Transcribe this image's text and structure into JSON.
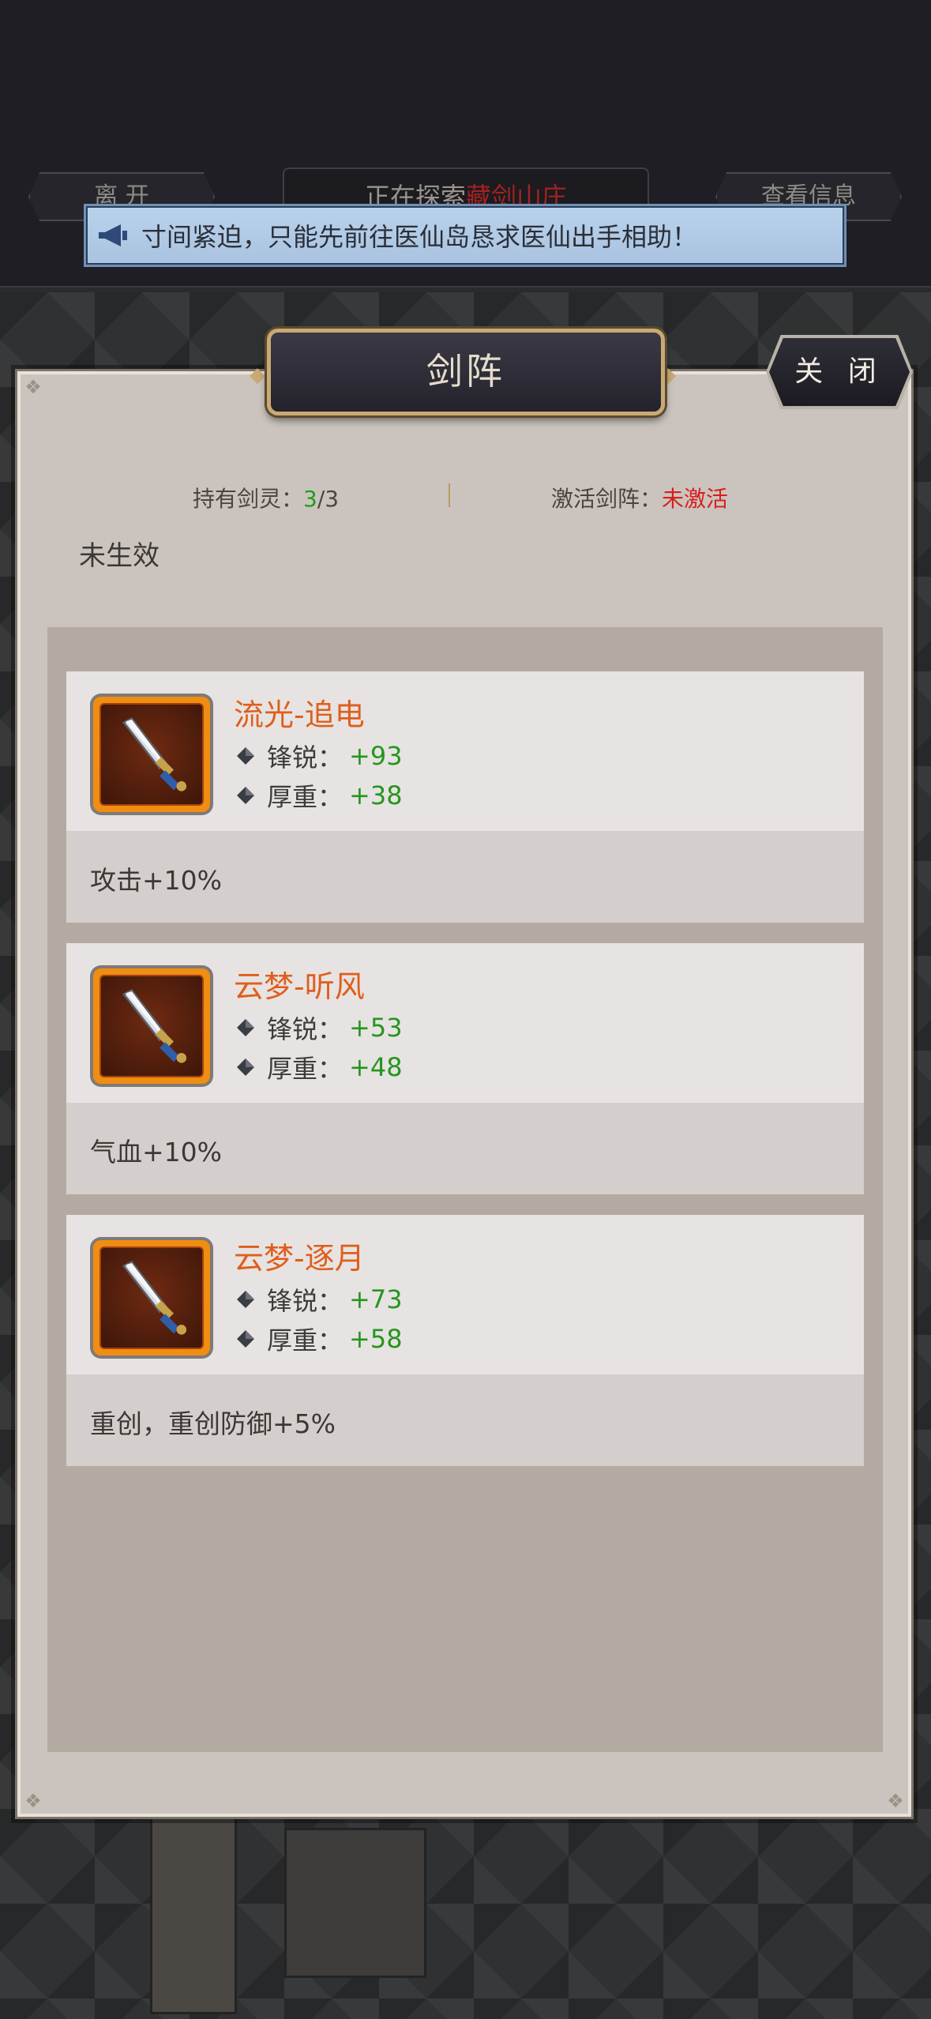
{
  "nav": {
    "left_label": "离 开",
    "center_prefix": "正在探索",
    "center_place": "藏剑山庄",
    "right_label": "查看信息"
  },
  "notice": {
    "icon": "megaphone-icon",
    "text": "寸间紧迫，只能先前往医仙岛恳求医仙出手相助！"
  },
  "panel": {
    "title": "剑阵",
    "close_label": "关 闭",
    "held_label": "持有剑灵：",
    "held_current": "3",
    "held_total": "/3",
    "active_label": "激活剑阵：",
    "active_value": "未激活",
    "effect_status": "未生效"
  },
  "cards": [
    {
      "name": "流光-追电",
      "icon": "sword-icon",
      "stat1_label": "锋锐：",
      "stat1_value": "+93",
      "stat2_label": "厚重：",
      "stat2_value": "+38",
      "bonus": "攻击+10%"
    },
    {
      "name": "云梦-听风",
      "icon": "sword-icon",
      "stat1_label": "锋锐：",
      "stat1_value": "+53",
      "stat2_label": "厚重：",
      "stat2_value": "+48",
      "bonus": "气血+10%"
    },
    {
      "name": "云梦-逐月",
      "icon": "sword-icon",
      "stat1_label": "锋锐：",
      "stat1_value": "+73",
      "stat2_label": "厚重：",
      "stat2_value": "+58",
      "bonus": "重创，重创防御+5%"
    }
  ],
  "colors": {
    "name_orange": "#df5e1c",
    "value_green": "#26951f",
    "inactive_red": "#d51f1f",
    "frame_orange": "#f08d12"
  }
}
